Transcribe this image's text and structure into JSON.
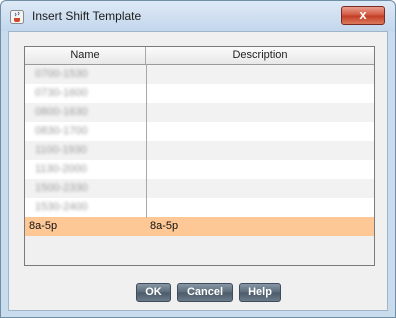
{
  "window": {
    "title": "Insert Shift Template",
    "close_label": "x"
  },
  "table": {
    "columns": [
      "Name",
      "Description"
    ],
    "rows": [
      {
        "name": "0700-1530",
        "description": "",
        "selected": false,
        "obscured": true
      },
      {
        "name": "0730-1600",
        "description": "",
        "selected": false,
        "obscured": true
      },
      {
        "name": "0800-1630",
        "description": "",
        "selected": false,
        "obscured": true
      },
      {
        "name": "0830-1700",
        "description": "",
        "selected": false,
        "obscured": true
      },
      {
        "name": "1100-1930",
        "description": "",
        "selected": false,
        "obscured": true
      },
      {
        "name": "1130-2000",
        "description": "",
        "selected": false,
        "obscured": true
      },
      {
        "name": "1500-2330",
        "description": "",
        "selected": false,
        "obscured": true
      },
      {
        "name": "1530-2400",
        "description": "",
        "selected": false,
        "obscured": true
      },
      {
        "name": "8a-5p",
        "description": "8a-5p",
        "selected": true,
        "obscured": false
      }
    ]
  },
  "buttons": {
    "ok": "OK",
    "cancel": "Cancel",
    "help": "Help"
  },
  "colors": {
    "selection": "#fdc896",
    "button": "#5b6a79",
    "close": "#c13b23"
  }
}
